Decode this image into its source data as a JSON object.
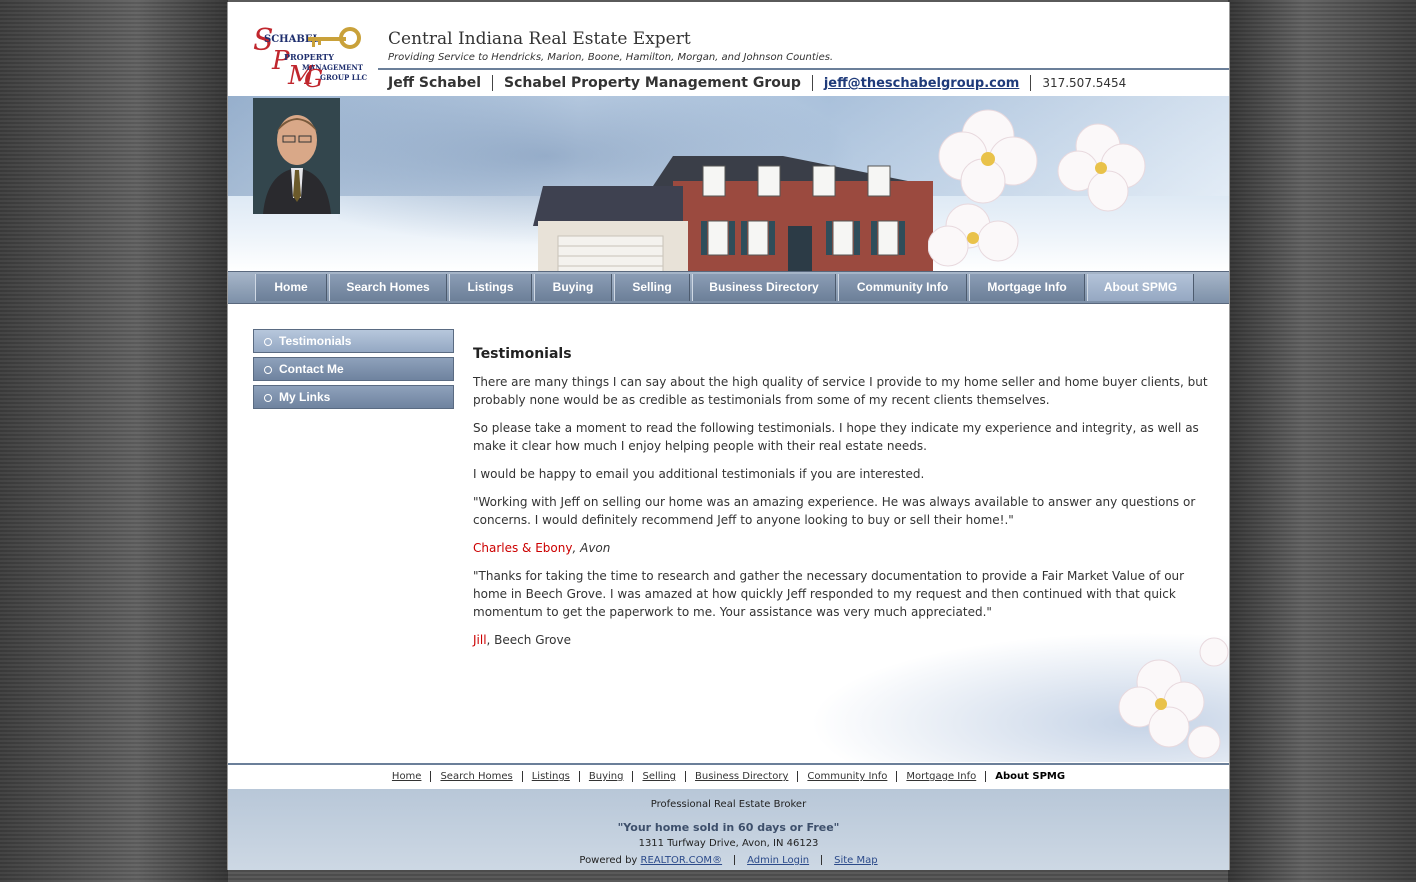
{
  "header": {
    "logo_text": [
      "SCHABEL",
      "PROPERTY",
      "MANAGEMENT",
      "GROUP LLC"
    ],
    "title": "Central Indiana Real Estate Expert",
    "tagline": "Providing Service to Hendricks, Marion, Boone, Hamilton, Morgan, and Johnson Counties.",
    "agent_name": "Jeff Schabel",
    "company": "Schabel Property Management Group",
    "email": "jeff@theschabelgroup.com",
    "phone": "317.507.5454"
  },
  "nav": {
    "items": [
      "Home",
      "Search Homes",
      "Listings",
      "Buying",
      "Selling",
      "Business Directory",
      "Community Info",
      "Mortgage Info",
      "About SPMG"
    ],
    "active": "About SPMG"
  },
  "sidebar": {
    "items": [
      "Testimonials",
      "Contact Me",
      "My Links"
    ],
    "active": "Testimonials"
  },
  "content": {
    "heading": "Testimonials",
    "p1": "There are many things I can say about the high quality of service I provide to my home seller and home buyer clients, but probably none would be as credible as testimonials from some of my recent clients themselves.",
    "p2": "So please take a moment to read the following testimonials. I hope they indicate my experience and integrity, as well as make it clear how much I enjoy helping people with their real estate needs.",
    "p3": "I would be happy to email you additional testimonials if you are interested.",
    "t1_quote": "\"Working with Jeff on selling our home was an amazing experience. He was always available to answer any questions or concerns. I would definitely recommend Jeff to anyone looking to buy or sell their home!.\"",
    "t1_name": "Charles & Ebony",
    "t1_city": ", Avon",
    "t2_quote": "\"Thanks for taking the time to research and gather the necessary documentation to provide a Fair Market Value of our home in Beech Grove. I was amazed at how quickly Jeff responded to my request and then continued with that quick momentum to get the paperwork to me. Your assistance was very much appreciated.\"",
    "t2_name": "Jill",
    "t2_city": ", Beech Grove"
  },
  "footer_links": {
    "items": [
      "Home",
      "Search Homes",
      "Listings",
      "Buying",
      "Selling",
      "Business Directory",
      "Community Info",
      "Mortgage Info"
    ],
    "current": "About SPMG"
  },
  "footer": {
    "line1": "Professional Real Estate Broker",
    "line2": "\"Your home sold in 60 days or Free\"",
    "line3": "1311 Turfway Drive, Avon, IN 46123",
    "powered_label": "Powered by ",
    "powered_link": "REALTOR.COM®",
    "admin": "Admin Login",
    "sitemap": "Site Map"
  },
  "colors": {
    "accent": "#6b7f99",
    "nav": "#7d90a8",
    "name_red": "#cc0000",
    "link_blue": "#1f3b7a"
  }
}
